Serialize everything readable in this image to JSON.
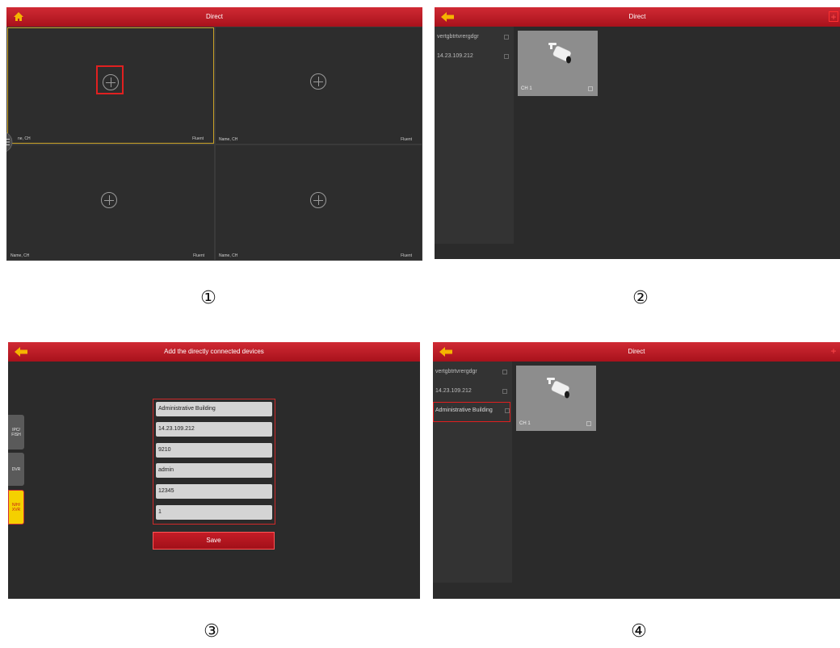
{
  "panel1": {
    "title": "Direct",
    "icons": {
      "home": "home-icon",
      "menu": "menu-icon",
      "add": "add-circle-icon"
    },
    "cells": [
      {
        "name": "Name, CH",
        "status": "Fluent"
      },
      {
        "name": "Name, CH",
        "status": "Fluent"
      },
      {
        "name": "Name, CH",
        "status": "Fluent"
      },
      {
        "name": "Name, CH",
        "status": "Fluent"
      }
    ],
    "first_cell_name": "ne, CH"
  },
  "panel2": {
    "title": "Direct",
    "devices": [
      "vertgbtrtvrergdgr",
      "14.23.109.212"
    ],
    "channel": "CH 1"
  },
  "panel3": {
    "title": "Add the directly connected devices",
    "tabs": [
      "IPC/ FISH",
      "DVR",
      "N/H/ XVR"
    ],
    "fields": [
      "Administrative Building",
      "14.23.109.212",
      "9210",
      "admin",
      "12345",
      "1"
    ],
    "save_label": "Save"
  },
  "panel4": {
    "title": "Direct",
    "devices": [
      "vertgbtrtvrergdgr",
      "14.23.109.212",
      "Administrative Building"
    ],
    "channel": "CH 1"
  },
  "step_labels": [
    "①",
    "②",
    "③",
    "④"
  ],
  "colors": {
    "titlebar": "#c01c26",
    "highlight": "#e02020",
    "active_tab": "#f5d000"
  }
}
